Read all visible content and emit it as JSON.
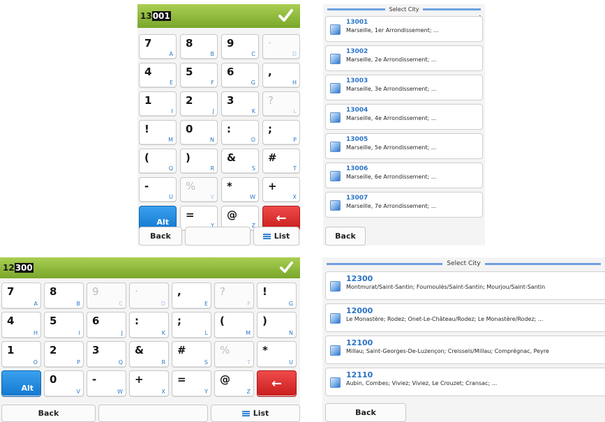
{
  "colors": {
    "header_green": "#8dbb3a",
    "alt_blue": "#1e88e5",
    "backspace_red": "#d62b2b",
    "code_blue": "#2a72c6",
    "title_bar_blue": "#6f9fe0"
  },
  "keypad_top": {
    "input_value": "13001",
    "input_prefix": "13",
    "input_selected": "001",
    "confirm_icon": "checkmark-icon",
    "keys": [
      {
        "ch": "7",
        "sub": "A"
      },
      {
        "ch": "8",
        "sub": "B"
      },
      {
        "ch": "9",
        "sub": "C"
      },
      {
        "ch": "·",
        "sub": "D",
        "dim": true
      },
      {
        "ch": "4",
        "sub": "E"
      },
      {
        "ch": "5",
        "sub": "F"
      },
      {
        "ch": "6",
        "sub": "G"
      },
      {
        "ch": ",",
        "sub": "H"
      },
      {
        "ch": "1",
        "sub": "I"
      },
      {
        "ch": "2",
        "sub": "J"
      },
      {
        "ch": "3",
        "sub": "K"
      },
      {
        "ch": "?",
        "sub": "L",
        "dim": true
      },
      {
        "ch": "!",
        "sub": "M"
      },
      {
        "ch": "0",
        "sub": "N"
      },
      {
        "ch": ":",
        "sub": "O"
      },
      {
        "ch": ";",
        "sub": "P"
      },
      {
        "ch": "(",
        "sub": "Q"
      },
      {
        "ch": ")",
        "sub": "R"
      },
      {
        "ch": "&",
        "sub": "S"
      },
      {
        "ch": "#",
        "sub": "T"
      },
      {
        "ch": "-",
        "sub": "U"
      },
      {
        "ch": "%",
        "sub": "V",
        "dim": true
      },
      {
        "ch": "*",
        "sub": "W"
      },
      {
        "ch": "+",
        "sub": "X"
      },
      {
        "ch": "Alt",
        "sub": "",
        "type": "alt"
      },
      {
        "ch": "=",
        "sub": "Y"
      },
      {
        "ch": "@",
        "sub": "Z"
      },
      {
        "ch": "←",
        "sub": "",
        "type": "back"
      }
    ],
    "footer": {
      "back": "Back",
      "middle": "",
      "list": "List"
    }
  },
  "keypad_bottom": {
    "input_value": "12300",
    "input_prefix": "12",
    "input_selected": "300",
    "confirm_icon": "checkmark-icon",
    "keys": [
      {
        "ch": "7",
        "sub": "A"
      },
      {
        "ch": "8",
        "sub": "B"
      },
      {
        "ch": "9",
        "sub": "C",
        "dim": true
      },
      {
        "ch": "·",
        "sub": "D",
        "dim": true
      },
      {
        "ch": ",",
        "sub": "E"
      },
      {
        "ch": "?",
        "sub": "F",
        "dim": true
      },
      {
        "ch": "!",
        "sub": "G"
      },
      {
        "ch": "4",
        "sub": "H"
      },
      {
        "ch": "5",
        "sub": "I"
      },
      {
        "ch": "6",
        "sub": "J"
      },
      {
        "ch": ":",
        "sub": "K"
      },
      {
        "ch": ";",
        "sub": "L"
      },
      {
        "ch": "(",
        "sub": "M"
      },
      {
        "ch": ")",
        "sub": "N"
      },
      {
        "ch": "1",
        "sub": "O"
      },
      {
        "ch": "2",
        "sub": "P"
      },
      {
        "ch": "3",
        "sub": "Q"
      },
      {
        "ch": "&",
        "sub": "R"
      },
      {
        "ch": "#",
        "sub": "S"
      },
      {
        "ch": "%",
        "sub": "T",
        "dim": true
      },
      {
        "ch": "*",
        "sub": "U"
      },
      {
        "ch": "Alt",
        "sub": "",
        "type": "alt"
      },
      {
        "ch": "0",
        "sub": "V"
      },
      {
        "ch": "-",
        "sub": "W"
      },
      {
        "ch": "+",
        "sub": "X"
      },
      {
        "ch": "=",
        "sub": "Y"
      },
      {
        "ch": "@",
        "sub": "Z"
      },
      {
        "ch": "←",
        "sub": "",
        "type": "back"
      }
    ],
    "footer": {
      "back": "Back",
      "middle": "",
      "list": "List"
    }
  },
  "city_list_top": {
    "title": "Select City",
    "back": "Back",
    "items": [
      {
        "code_prefix": "13",
        "code_rest": "001",
        "name": "Marseille, 1er Arrondissement; ..."
      },
      {
        "code_prefix": "13",
        "code_rest": "002",
        "name": "Marseille, 2e Arrondissement; ..."
      },
      {
        "code_prefix": "13",
        "code_rest": "003",
        "name": "Marseille, 3e Arrondissement; ..."
      },
      {
        "code_prefix": "13",
        "code_rest": "004",
        "name": "Marseille, 4e Arrondissement; ..."
      },
      {
        "code_prefix": "13",
        "code_rest": "005",
        "name": "Marseille, 5e Arrondissement; ..."
      },
      {
        "code_prefix": "13",
        "code_rest": "006",
        "name": "Marseille, 6e Arrondissement; ..."
      },
      {
        "code_prefix": "13",
        "code_rest": "007",
        "name": "Marseille, 7e Arrondissement; ..."
      }
    ]
  },
  "city_list_bottom": {
    "title": "Select City",
    "back": "Back",
    "items": [
      {
        "code_prefix": "12",
        "code_rest": "300",
        "name": "Montmurat/Saint-Santin; Fournoulès/Saint-Santin; Mourjou/Saint-Santin"
      },
      {
        "code_prefix": "12",
        "code_rest": "000",
        "name": "Le Monastère; Rodez; Onet-Le-Château/Rodez; Le Monastère/Rodez; ..."
      },
      {
        "code_prefix": "12",
        "code_rest": "100",
        "name": "Millau; Saint-Georges-De-Luzençon; Creissels/Millau; Comprégnac, Peyre"
      },
      {
        "code_prefix": "12",
        "code_rest": "110",
        "name": "Aubin, Combes; Viviez; Viviez, Le Crouzet; Cransac; ..."
      }
    ]
  }
}
